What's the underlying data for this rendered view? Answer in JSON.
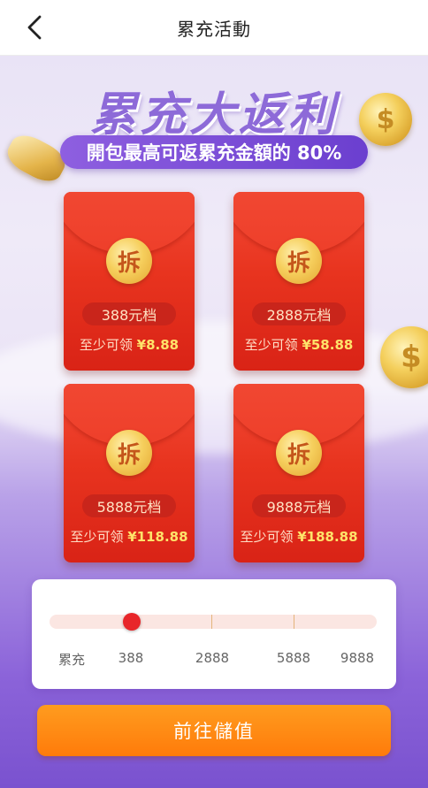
{
  "nav": {
    "back_icon": "chevron-left-icon",
    "title": "累充活動"
  },
  "banner": {
    "headline": "累充大返利",
    "subtitle": "開包最高可返累充金額的 80%"
  },
  "envelopes": [
    {
      "seal": "拆",
      "tier": "388元档",
      "reward_prefix": "至少可领 ",
      "reward_amount": "¥8.88"
    },
    {
      "seal": "拆",
      "tier": "2888元档",
      "reward_prefix": "至少可领 ",
      "reward_amount": "¥58.88"
    },
    {
      "seal": "拆",
      "tier": "5888元档",
      "reward_prefix": "至少可领 ",
      "reward_amount": "¥118.88"
    },
    {
      "seal": "拆",
      "tier": "9888元档",
      "reward_prefix": "至少可领 ",
      "reward_amount": "¥188.88"
    }
  ],
  "progress": {
    "label": "累充",
    "milestones": [
      "388",
      "2888",
      "5888",
      "9888"
    ],
    "current_milestone_index": 0,
    "knob_color": "#e8262a"
  },
  "cta": {
    "label": "前往儲值",
    "color": "#ff8a12"
  },
  "colors": {
    "accent": "#8d6ad8",
    "envelope_red": "#e8341f",
    "gold": "#f4cf5c"
  }
}
